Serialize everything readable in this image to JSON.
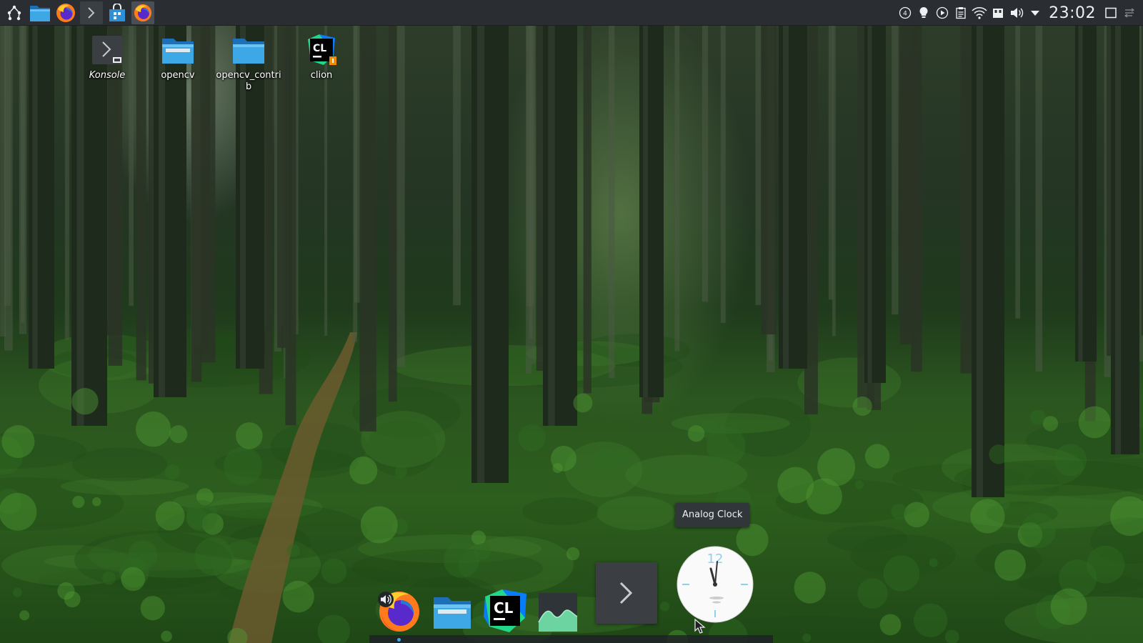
{
  "top_panel": {
    "launchers": [
      {
        "name": "application-launcher",
        "icon": "kde-menu-icon"
      },
      {
        "name": "file-manager",
        "icon": "folder-icon"
      },
      {
        "name": "firefox",
        "icon": "firefox-icon"
      },
      {
        "name": "konsole",
        "icon": "terminal-icon"
      },
      {
        "name": "discover",
        "icon": "store-icon"
      },
      {
        "name": "firefox-task",
        "icon": "firefox-icon"
      }
    ],
    "tray_icons": [
      "badge-4-icon",
      "bulb-icon",
      "media-play-icon",
      "clipboard-icon",
      "wifi-icon",
      "storage-icon",
      "volume-icon",
      "expand-arrow-icon"
    ],
    "tray_badge_number": "4",
    "clock": "23:02"
  },
  "desktop_icons": [
    {
      "label": "Konsole",
      "icon": "terminal-icon"
    },
    {
      "label": "opencv",
      "icon": "folder-icon"
    },
    {
      "label": "opencv_contrib",
      "icon": "folder-icon"
    },
    {
      "label": "clion",
      "icon": "clion-icon"
    }
  ],
  "dock": {
    "items": [
      "firefox-icon",
      "folder-icon",
      "clion-icon",
      "system-monitor-icon",
      "terminal-icon"
    ],
    "tooltip": "Analog Clock",
    "clock_numeral": "12",
    "clock_time": "23:02"
  },
  "colors": {
    "panel": "#2a2e32",
    "accent": "#3daee9",
    "folder": "#3ea8e6",
    "clion_green": "#21d789",
    "clion_blue": "#087cfa"
  }
}
